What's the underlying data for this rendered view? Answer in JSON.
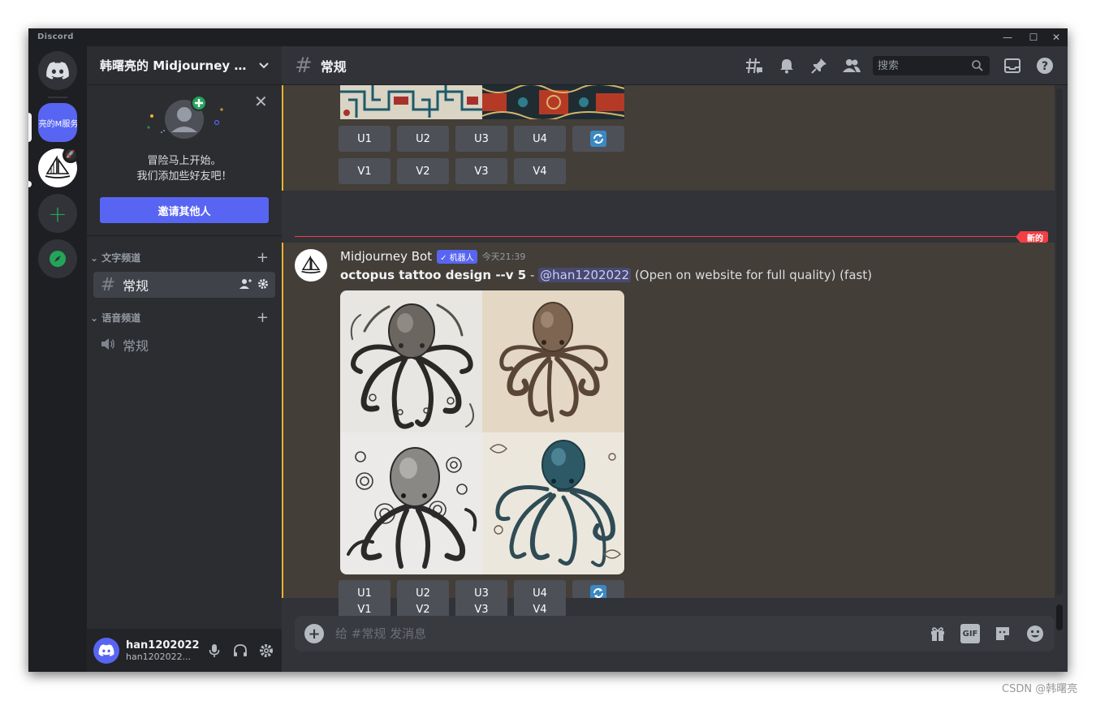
{
  "window": {
    "brand": "Discord",
    "controls": [
      "—",
      "☐",
      "✕"
    ]
  },
  "rail": {
    "server_label": "晷亮的M服务",
    "badge_icon": "rocket-icon"
  },
  "server": {
    "name": "韩曙亮的 Midjourney 服...",
    "invite_line1": "冒险马上开始。",
    "invite_line2": "我们添加些好友吧！",
    "invite_button": "邀请其他人",
    "text_category": "文字频道",
    "voice_category": "语音频道",
    "text_channel": "常规",
    "voice_channel": "常规"
  },
  "user": {
    "name": "han1202022",
    "tag": "han1202022..."
  },
  "header": {
    "channel": "常规",
    "search_placeholder": "搜索"
  },
  "messages": {
    "upscale_buttons": [
      "U1",
      "U2",
      "U3",
      "U4"
    ],
    "variation_buttons": [
      "V1",
      "V2",
      "V3",
      "V4"
    ],
    "new_label": "新的",
    "author": "Midjourney Bot",
    "bot_badge": "✓ 机器人",
    "timestamp": "今天21:39",
    "prompt": "octopus tattoo design --v 5",
    "separator": " - ",
    "mention": "@han1202022",
    "suffix": " (Open on website for full quality) (fast)"
  },
  "composer": {
    "placeholder": "给 #常规 发消息",
    "gif_label": "GIF"
  },
  "watermark": "CSDN @韩曙亮",
  "colors": {
    "blurple": "#5865f2",
    "highlight": "#433e38",
    "highlight_border": "#f0b232",
    "new_red": "#f23f43"
  }
}
